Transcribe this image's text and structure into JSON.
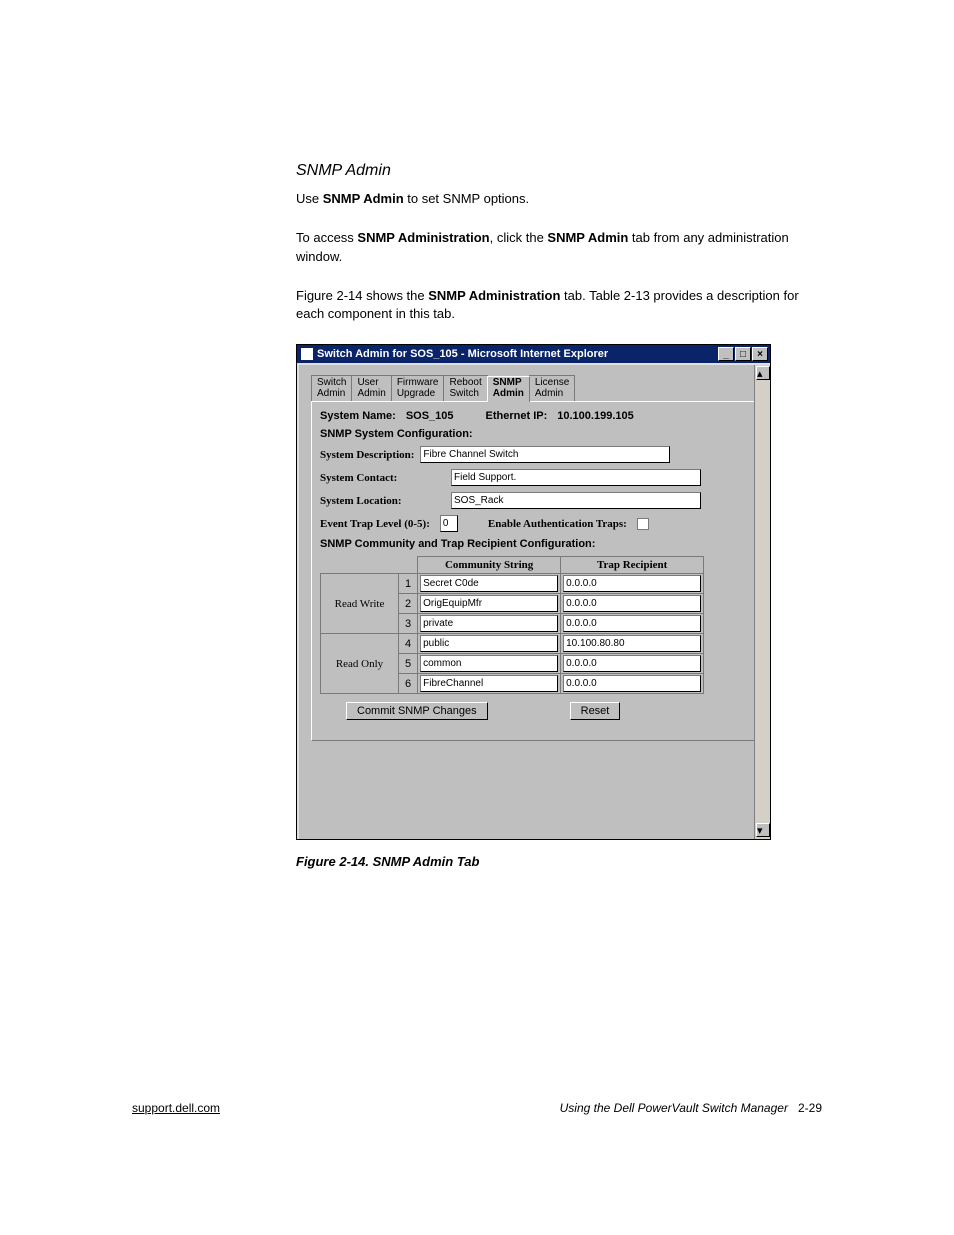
{
  "section": {
    "heading": "SNMP Admin",
    "para1_pre": "Use ",
    "para1_bold": "SNMP Admin",
    "para1_post": " to set SNMP options.",
    "para2_pre": "To access ",
    "para2_bold1": "SNMP Administration",
    "para2_mid": ", click the ",
    "para2_bold2": "SNMP Admin",
    "para2_post": " tab from any administration window.",
    "para3_pre": "Figure 2-14 shows the ",
    "para3_bold": "SNMP Administration",
    "para3_post": " tab. Table 2-13 provides a description for each component in this tab."
  },
  "window": {
    "title": "Switch Admin for SOS_105 - Microsoft Internet Explorer",
    "title_icon": "ie-page-icon",
    "controls": {
      "min": "_",
      "max": "□",
      "close": "×"
    },
    "tabs": [
      {
        "l1": "Switch",
        "l2": "Admin"
      },
      {
        "l1": "User",
        "l2": "Admin"
      },
      {
        "l1": "Firmware",
        "l2": "Upgrade"
      },
      {
        "l1": "Reboot",
        "l2": "Switch"
      },
      {
        "l1": "SNMP",
        "l2": "Admin"
      },
      {
        "l1": "License",
        "l2": "Admin"
      }
    ],
    "active_tab_index": 4,
    "info": {
      "system_name_label": "System Name:",
      "system_name_value": "SOS_105",
      "ethernet_ip_label": "Ethernet IP:",
      "ethernet_ip_value": "10.100.199.105"
    },
    "snmp_header": "SNMP System Configuration:",
    "fields": {
      "system_description_label": "System Description:",
      "system_description_value": "Fibre Channel Switch",
      "system_contact_label": "System Contact:",
      "system_contact_value": "Field Support.",
      "system_location_label": "System Location:",
      "system_location_value": "SOS_Rack",
      "event_trap_level_label": "Event Trap Level (0-5):",
      "event_trap_level_value": "0",
      "enable_auth_traps_label": "Enable Authentication Traps:"
    },
    "community_header": "SNMP Community and Trap Recipient Configuration:",
    "table": {
      "col_community": "Community String",
      "col_trap": "Trap Recipient",
      "rw_label": "Read Write",
      "ro_label": "Read Only",
      "rows": [
        {
          "n": "1",
          "community": "Secret C0de",
          "trap": "0.0.0.0"
        },
        {
          "n": "2",
          "community": "OrigEquipMfr",
          "trap": "0.0.0.0"
        },
        {
          "n": "3",
          "community": "private",
          "trap": "0.0.0.0"
        },
        {
          "n": "4",
          "community": "public",
          "trap": "10.100.80.80"
        },
        {
          "n": "5",
          "community": "common",
          "trap": "0.0.0.0"
        },
        {
          "n": "6",
          "community": "FibreChannel",
          "trap": "0.0.0.0"
        }
      ]
    },
    "buttons": {
      "commit": "Commit SNMP Changes",
      "reset": "Reset"
    }
  },
  "figure_caption": "Figure 2-14.  SNMP Admin Tab",
  "footer": {
    "left": "support.dell.com",
    "right_italic": "Using the Dell PowerVault Switch Manager",
    "right_page": "2-29"
  }
}
